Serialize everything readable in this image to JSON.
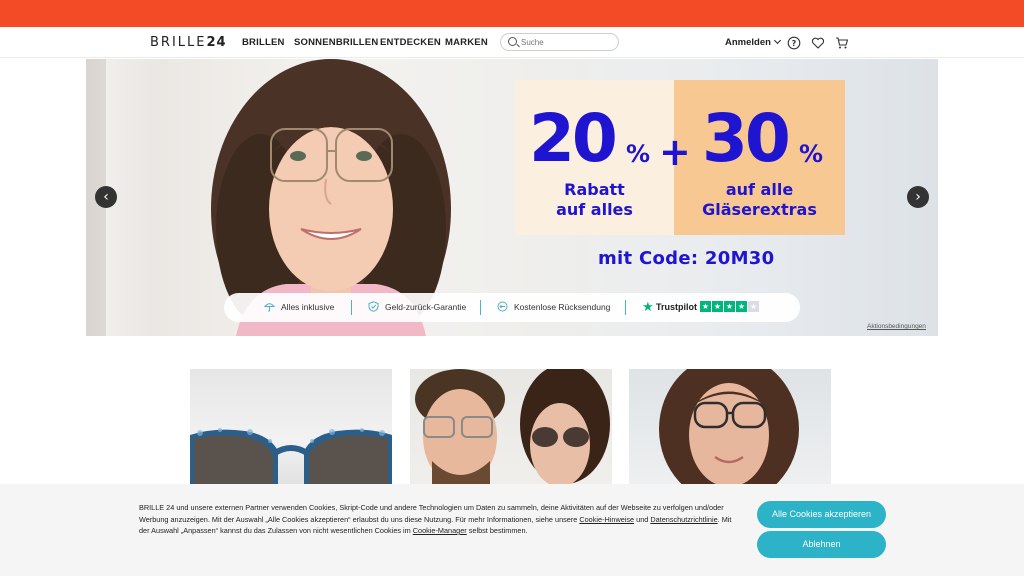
{
  "colors": {
    "topbar": "#f44b27",
    "promo_text": "#1f14cf",
    "accent": "#2db3c7",
    "trustpilot": "#00b67a"
  },
  "header": {
    "logo_light": "BRILLE",
    "logo_bold": "24",
    "nav": [
      "BRILLEN",
      "SONNENBRILLEN",
      "ENTDECKEN",
      "MARKEN"
    ],
    "search_placeholder": "Suche",
    "login_label": "Anmelden",
    "icons": [
      "help-icon",
      "heart-icon",
      "cart-icon"
    ]
  },
  "hero": {
    "promo_left_number": "20",
    "promo_left_percent": "%",
    "plus": "+",
    "promo_right_number": "30",
    "promo_right_percent": "%",
    "promo_left_line1": "Rabatt",
    "promo_left_line2": "auf alles",
    "promo_right_line1": "auf alle",
    "promo_right_line2": "Gläserextras",
    "code_text": "mit Code: 20M30",
    "usp": [
      "Alles inklusive",
      "Geld-zurück-Garantie",
      "Kostenlose Rücksendung"
    ],
    "trustpilot_label": "Trustpilot",
    "trustpilot_rating_stars": 4,
    "terms_link": "Aktionsbedingungen",
    "prev_icon": "chevron-left-icon",
    "next_icon": "chevron-right-icon"
  },
  "categories": [
    "sunglasses-product",
    "couple-with-glasses",
    "woman-with-glasses"
  ],
  "cookie": {
    "text_1": "BRILLE 24 und unsere externen Partner verwenden Cookies, Skript-Code und andere Technologien um Daten zu sammeln, deine Aktivitäten auf der Webseite zu verfolgen und/oder Werbung anzuzeigen. Mit der Auswahl „Alle Cookies akzeptieren“ erlaubst du uns diese Nutzung. Für mehr Informationen, siehe unsere ",
    "link_1": "Cookie-Hinweise",
    "text_2": " und ",
    "link_2": "Datenschutzrichtlinie",
    "text_3": ". Mit der Auswahl „Anpassen“ kannst du das Zulassen von nicht wesentlichen Cookies im ",
    "link_3": "Cookie-Manager",
    "text_4": " selbst bestimmen.",
    "accept_label": "Alle Cookies akzeptieren",
    "decline_label": "Ablehnen"
  }
}
